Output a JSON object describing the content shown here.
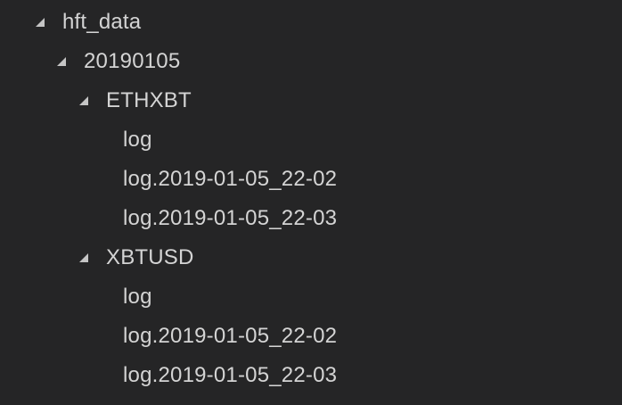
{
  "explorer": {
    "root": {
      "label": "hft_data",
      "icon": "chevron-expanded-icon"
    },
    "date_folder": {
      "label": "20190105",
      "icon": "chevron-expanded-icon"
    },
    "folders": [
      {
        "label": "ETHXBT",
        "icon": "chevron-expanded-icon",
        "files": [
          "log",
          "log.2019-01-05_22-02",
          "log.2019-01-05_22-03"
        ]
      },
      {
        "label": "XBTUSD",
        "icon": "chevron-expanded-icon",
        "files": [
          "log",
          "log.2019-01-05_22-02",
          "log.2019-01-05_22-03"
        ]
      }
    ]
  },
  "colors": {
    "background": "#252526",
    "text": "#d4d4d4",
    "twistie": "#c5c5c5"
  }
}
